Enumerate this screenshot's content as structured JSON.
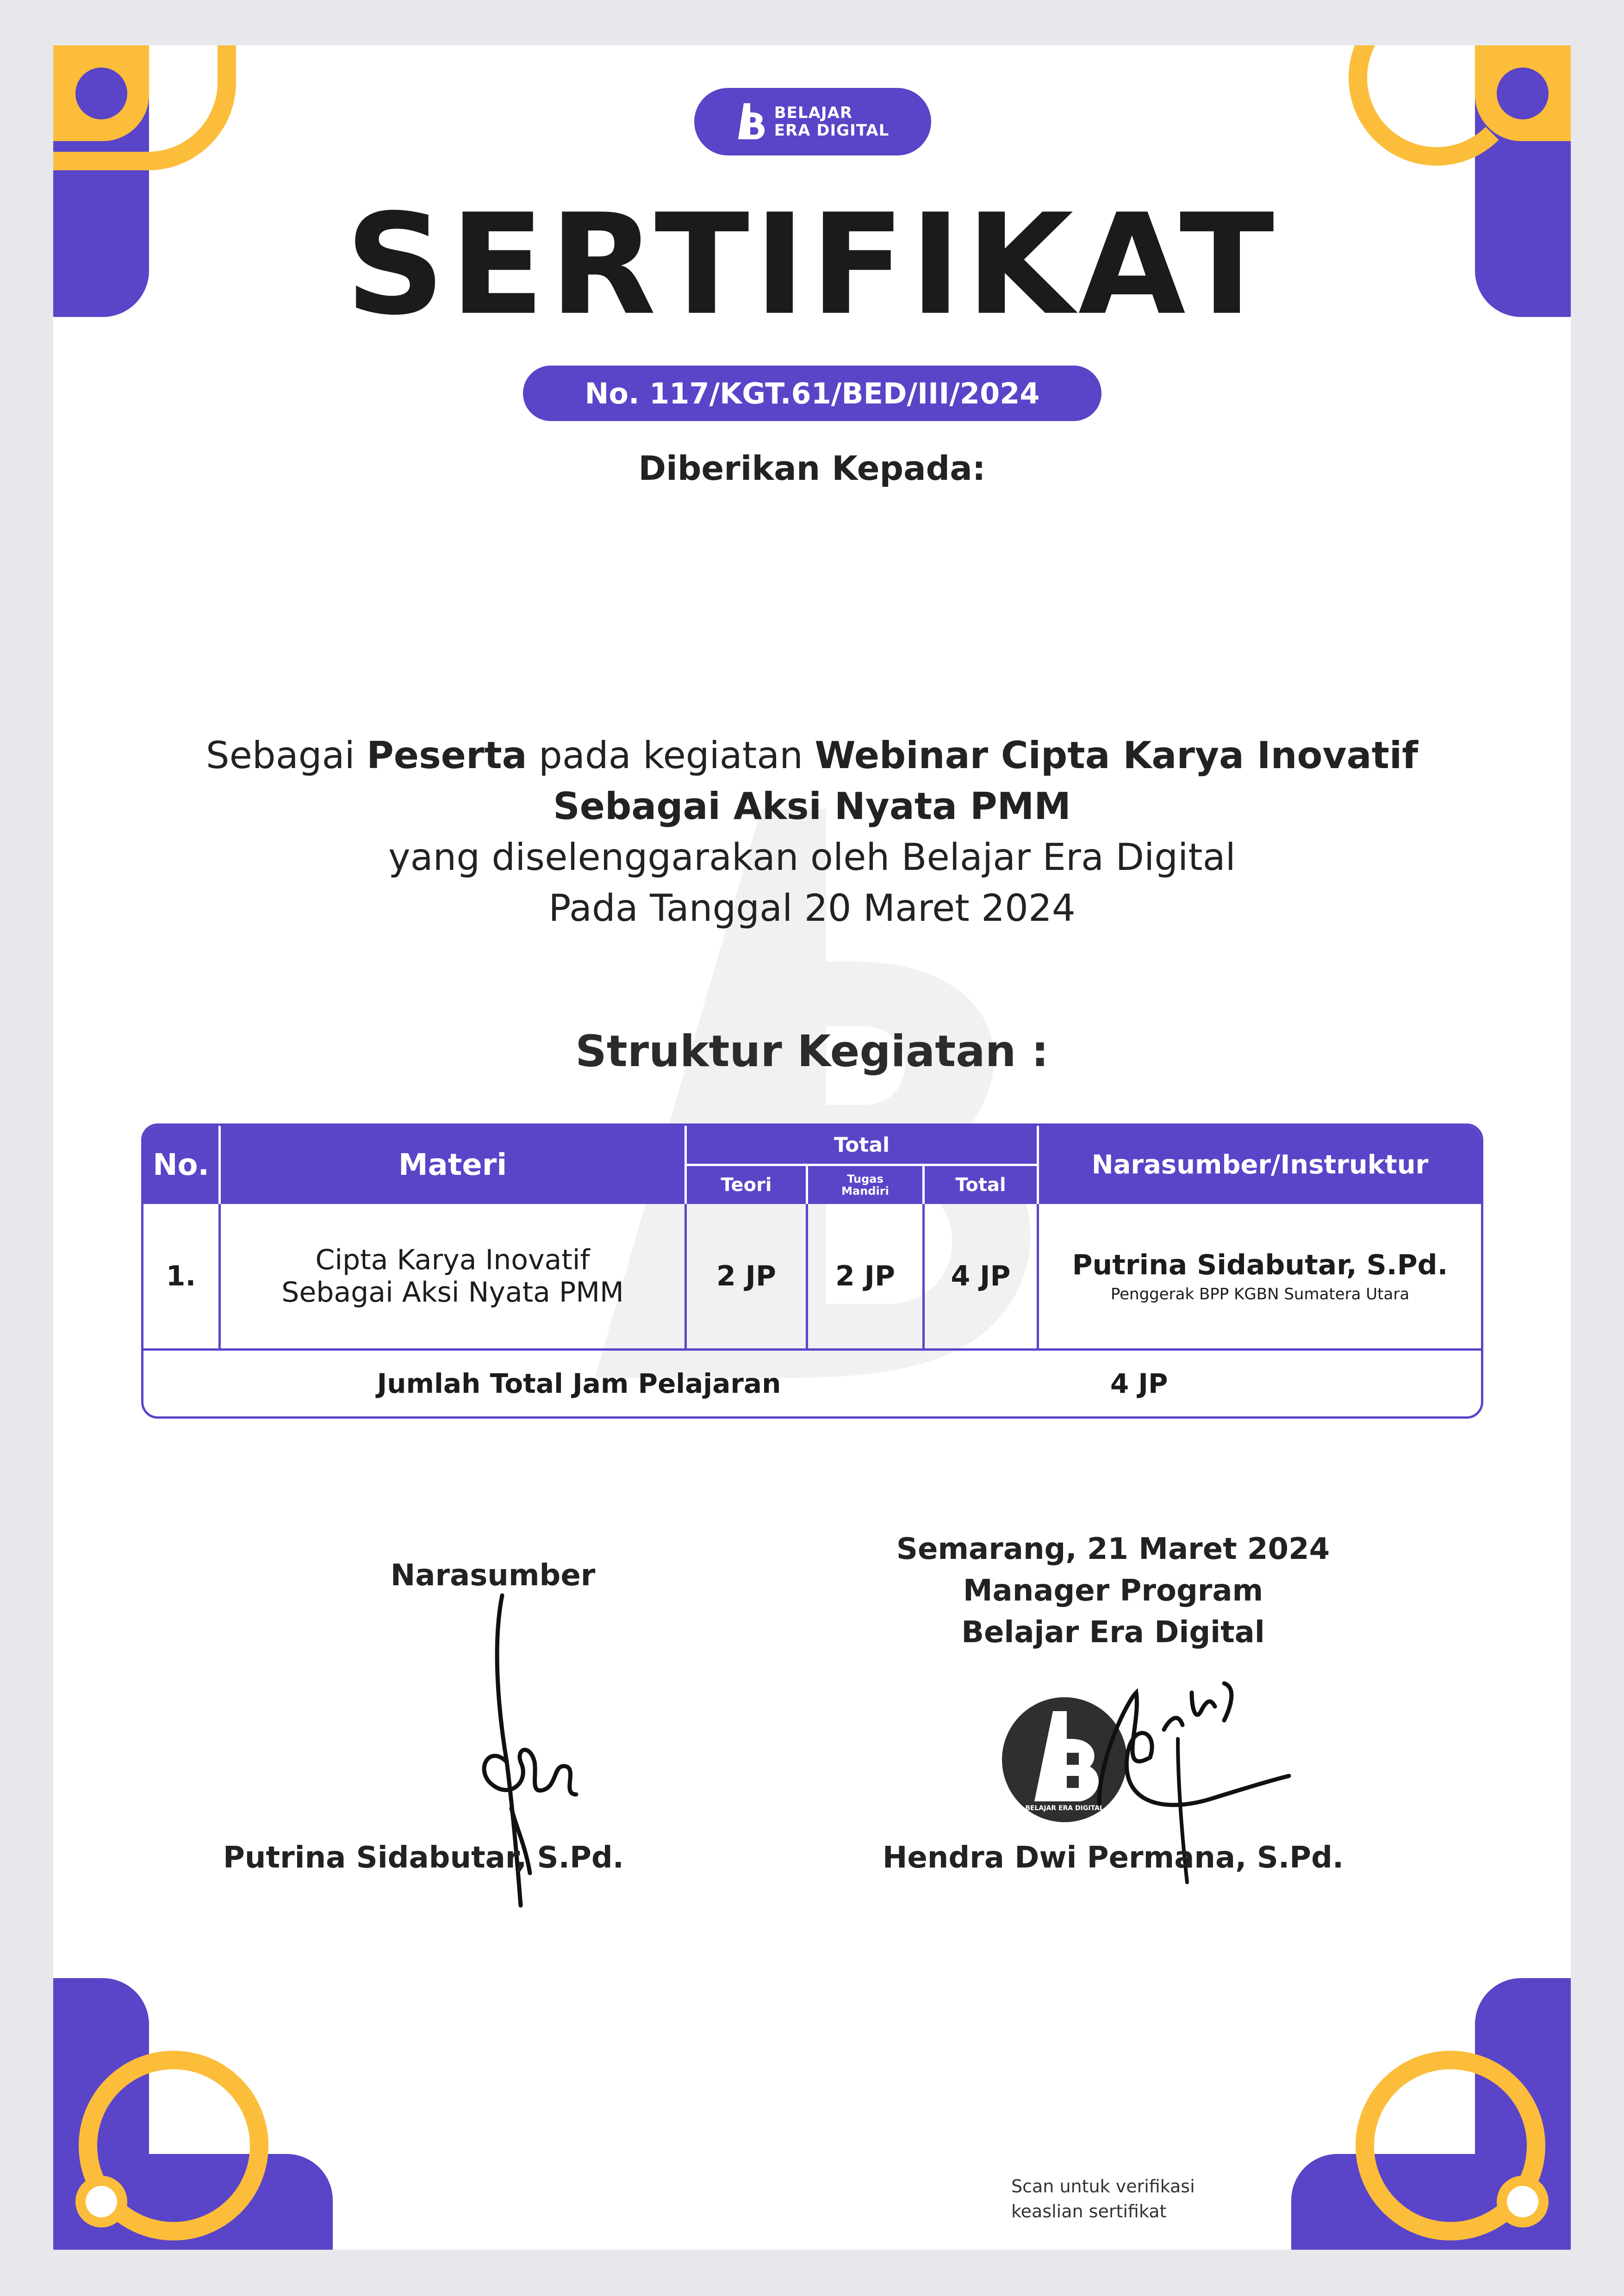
{
  "brand": {
    "line1": "BELAJAR",
    "line2": "ERA DIGITAL",
    "purple": "#5a44c8",
    "yellow": "#fbbd3a"
  },
  "title": "SERTIFIKAT",
  "certificate_number": "No. 117/KGT.61/BED/III/2024",
  "given_to": "Diberikan Kepada:",
  "description": {
    "p1": "Sebagai ",
    "b1": "Peserta",
    "p2": " pada kegiatan ",
    "b2": "Webinar Cipta Karya Inovatif Sebagai Aksi Nyata PMM",
    "line3": "yang diselenggarakan oleh Belajar Era Digital",
    "line4": "Pada Tanggal 20 Maret 2024"
  },
  "structure_title": "Struktur Kegiatan :",
  "table": {
    "headers": {
      "no": "No.",
      "materi": "Materi",
      "total_group": "Total",
      "teori": "Teori",
      "tugas": "Tugas",
      "mandiri": "Mandiri",
      "total": "Total",
      "narasumber": "Narasumber/Instruktur"
    },
    "rows": [
      {
        "no": "1.",
        "materi_line1": "Cipta Karya Inovatif",
        "materi_line2": "Sebagai Aksi Nyata PMM",
        "teori": "2 JP",
        "tugas": "2 JP",
        "total": "4 JP",
        "narasumber": "Putrina Sidabutar, S.Pd.",
        "narasumber_role": "Penggerak BPP KGBN Sumatera Utara"
      }
    ],
    "total_label": "Jumlah Total Jam Pelajaran",
    "total_value": "4 JP"
  },
  "signatures": {
    "left": {
      "label": "Narasumber",
      "name": "Putrina Sidabutar, S.Pd."
    },
    "right": {
      "place_date": "Semarang, 21 Maret 2024",
      "position": "Manager Program",
      "organization": "Belajar Era Digital",
      "stamp_text": "BELAJAR ERA DIGITAL",
      "name": "Hendra Dwi Permana, S.Pd."
    }
  },
  "verification_note": {
    "line1": "Scan untuk verifikasi",
    "line2": "keaslian sertifikat"
  }
}
